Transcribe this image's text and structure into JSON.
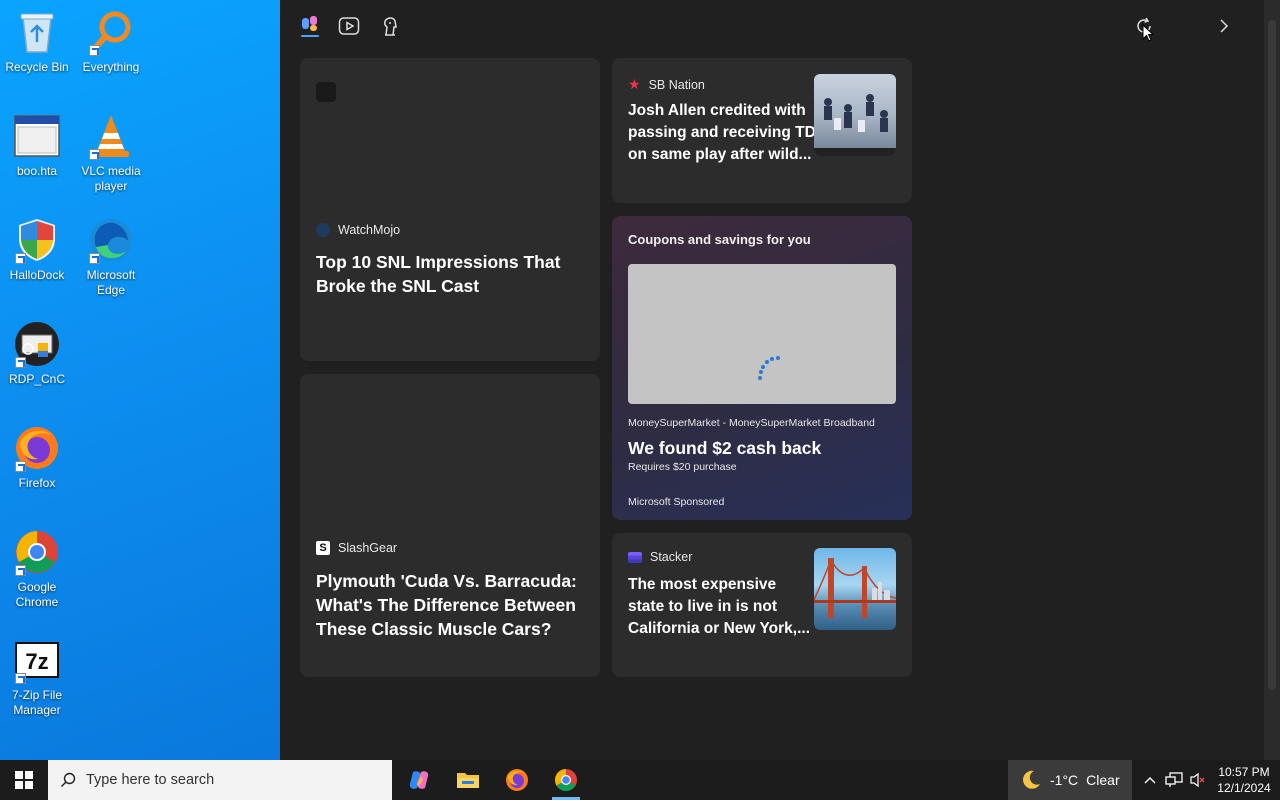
{
  "desktop": {
    "icons": [
      {
        "label": "Recycle Bin"
      },
      {
        "label": "Everything"
      },
      {
        "label": "boo.hta"
      },
      {
        "label": "VLC media player"
      },
      {
        "label": "HalloDock"
      },
      {
        "label": "Microsoft Edge"
      },
      {
        "label": "RDP_CnC"
      },
      {
        "label": "Firefox"
      },
      {
        "label": "Google Chrome"
      },
      {
        "label": "7-Zip File Manager"
      }
    ]
  },
  "widgets": {
    "cards": {
      "watchmojo": {
        "source": "WatchMojo",
        "headline": "Top 10 SNL Impressions That Broke the SNL Cast"
      },
      "sbnation": {
        "source": "SB Nation",
        "headline": "Josh Allen credited with passing and receiving TD on same play after wild..."
      },
      "coupons": {
        "title": "Coupons and savings for you",
        "advertiser": "MoneySuperMarket - MoneySuperMarket Broadband",
        "offer": "We found $2 cash back",
        "condition": "Requires $20 purchase",
        "sponsor": "Microsoft Sponsored"
      },
      "slashgear": {
        "source": "SlashGear",
        "headline": "Plymouth 'Cuda Vs. Barracuda: What's The Difference Between These Classic Muscle Cars?"
      },
      "stacker": {
        "source": "Stacker",
        "headline": "The most expensive state to live in is not California or New York,..."
      }
    }
  },
  "taskbar": {
    "search_placeholder": "Type here to search",
    "weather": {
      "temp": "-1°C",
      "condition": "Clear"
    },
    "clock": {
      "time": "10:57 PM",
      "date": "12/1/2024"
    }
  },
  "colors": {
    "panel_bg": "#202020",
    "card_bg": "#2c2c2c",
    "desktop_blue": "#0d8ff0",
    "accent_blue": "#3a8ee6"
  }
}
